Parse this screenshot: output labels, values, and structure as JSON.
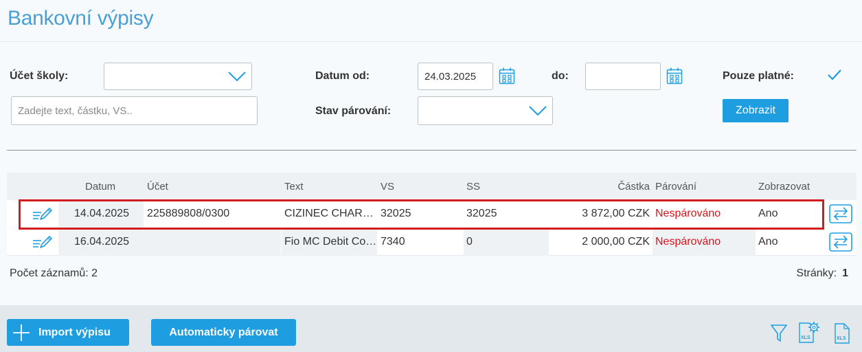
{
  "page": {
    "title": "Bankovní výpisy"
  },
  "filters": {
    "school_account_label": "Účet školy:",
    "school_account_value": "",
    "search_placeholder": "Zadejte text, částku, VS..",
    "date_from_label": "Datum od:",
    "date_from_value": "24.03.2025",
    "date_to_label": "do:",
    "date_to_value": "",
    "pairing_state_label": "Stav párování:",
    "pairing_state_value": "",
    "valid_only_label": "Pouze platné:",
    "valid_only_checked": true,
    "show_button": "Zobrazit"
  },
  "table": {
    "columns": {
      "datum": "Datum",
      "ucet": "Účet",
      "text": "Text",
      "vs": "VS",
      "ss": "SS",
      "castka": "Částka",
      "parovani": "Párování",
      "zobrazovat": "Zobrazovat"
    },
    "rows": [
      {
        "datum": "14.04.2025",
        "ucet": "225889808/0300",
        "text": "CIZINEC CHARLES BIRD",
        "vs": "32025",
        "ss": "32025",
        "castka": "3 872,00 CZK",
        "parovani": "Nespárováno",
        "zobrazovat": "Ano"
      },
      {
        "datum": "16.04.2025",
        "ucet": "",
        "text": "Fio MC Debit Corporate",
        "vs": "7340",
        "ss": "0",
        "castka": "2 000,00 CZK",
        "parovani": "Nespárováno",
        "zobrazovat": "Ano"
      }
    ],
    "record_count": "Počet záznamů: 2",
    "pages_label": "Stránky:",
    "current_page": "1"
  },
  "actions": {
    "import_button": "Import výpisu",
    "auto_pair_button": "Automaticky párovat"
  },
  "icons": [
    "calendar-icon",
    "chevron-down-icon",
    "checkmark-icon",
    "edit-icon",
    "pair-arrows-icon",
    "plus-icon",
    "filter-icon",
    "xls-settings-icon",
    "xls-export-icon"
  ],
  "colors": {
    "accent": "#1e9ee0",
    "title": "#4aa0d3",
    "unpaired": "#d8141b",
    "highlight": "#d31b20"
  }
}
